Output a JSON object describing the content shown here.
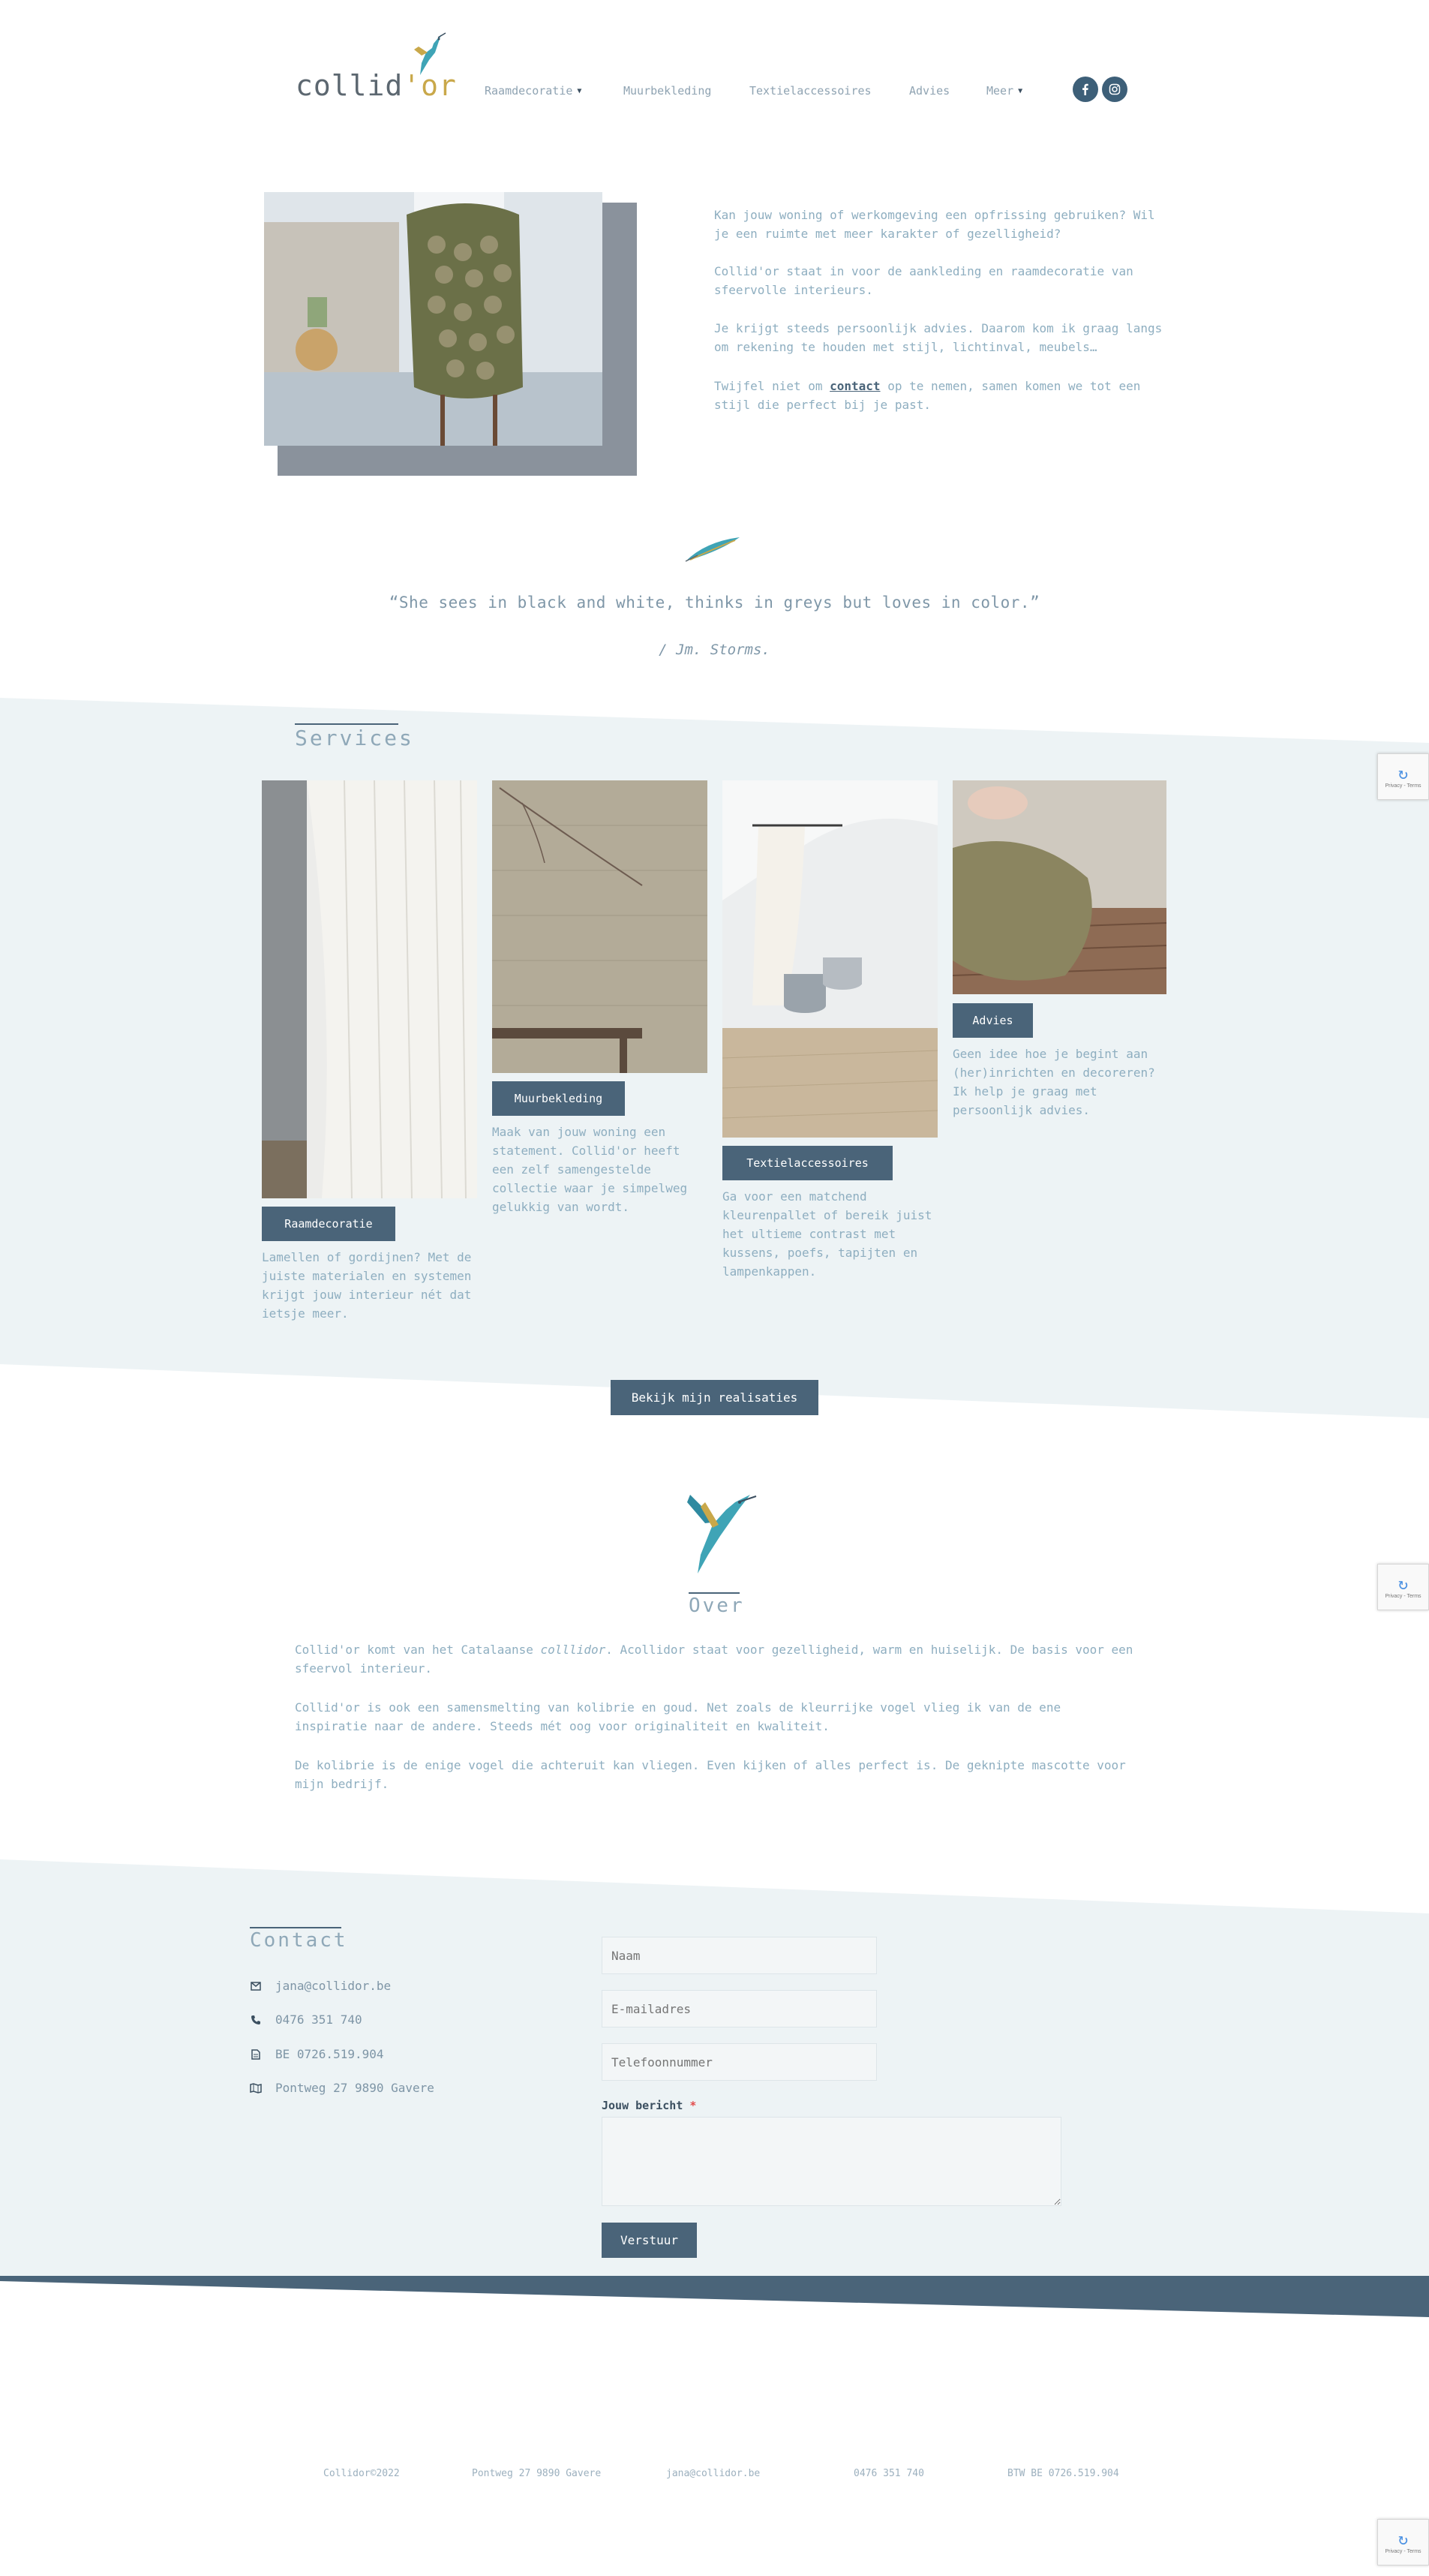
{
  "brand": {
    "name_main": "collid",
    "name_accent": "'or",
    "accent_color": "#c9a84a"
  },
  "nav": {
    "items": [
      {
        "label": "Raamdecoratie",
        "has_dropdown": true
      },
      {
        "label": "Muurbekleding",
        "has_dropdown": false
      },
      {
        "label": "Textielaccessoires",
        "has_dropdown": false
      },
      {
        "label": "Advies",
        "has_dropdown": false
      },
      {
        "label": "Meer",
        "has_dropdown": true
      }
    ],
    "social": [
      "facebook-icon",
      "instagram-icon"
    ]
  },
  "intro": {
    "p1": "Kan jouw woning of werkomgeving een opfrissing gebruiken? Wil je een ruimte met meer karakter of gezelligheid?",
    "p2": "Collid'or staat in voor de aankleding en raamdecoratie van sfeervolle interieurs.",
    "p3": "Je krijgt steeds persoonlijk advies. Daarom kom ik graag langs om rekening te houden met stijl, lichtinval, meubels…",
    "p4_before": "Twijfel niet om ",
    "p4_link": "contact",
    "p4_after": " op te nemen, samen komen we tot een stijl die perfect bij je past."
  },
  "quote": {
    "text": "“She sees in black and white, thinks in greys but loves in color.”",
    "author": "/ Jm. Storms."
  },
  "services": {
    "title": "Services",
    "items": [
      {
        "label": "Raamdecoratie",
        "desc": "Lamellen of gordijnen? Met de juiste materialen en systemen krijgt jouw interieur nét dat ietsje meer."
      },
      {
        "label": "Muurbekleding",
        "desc": "Maak van jouw woning een statement. Collid'or heeft een zelf samengestelde collectie waar je simpelweg gelukkig van wordt."
      },
      {
        "label": "Textielaccessoires",
        "desc": "Ga voor een matchend kleurenpallet of bereik juist het ultieme contrast met kussens, poefs, tapijten en lampenkappen."
      },
      {
        "label": "Advies",
        "desc": "Geen idee hoe je begint aan (her)inrichten en decoreren? Ik help je graag met persoonlijk advies."
      }
    ],
    "cta": "Bekijk mijn realisaties"
  },
  "about": {
    "title": "Over",
    "p1_before": "Collid'or komt van het Catalaanse ",
    "p1_em": "colllidor",
    "p1_after": ". Acollidor staat voor gezelligheid, warm en huiselijk. De basis voor een sfeervol interieur.",
    "p2": "Collid'or is ook een samensmelting van kolibrie en goud. Net zoals de kleurrijke vogel vlieg ik van de ene inspiratie naar de andere. Steeds mét oog voor originaliteit en kwaliteit.",
    "p3": "De kolibrie is de enige vogel die achteruit kan vliegen. Even kijken of alles perfect is. De geknipte mascotte voor mijn bedrijf."
  },
  "contact": {
    "title": "Contact",
    "info": [
      {
        "icon": "envelope-icon",
        "text": "jana@collidor.be"
      },
      {
        "icon": "phone-icon",
        "text": "0476 351 740"
      },
      {
        "icon": "document-icon",
        "text": "BE 0726.519.904"
      },
      {
        "icon": "map-icon",
        "text": "Pontweg 27 9890 Gavere"
      }
    ],
    "form": {
      "name_placeholder": "Naam",
      "email_placeholder": "E-mailadres",
      "phone_placeholder": "Telefoonnummer",
      "message_label": "Jouw bericht",
      "required_mark": "*",
      "submit": "Verstuur"
    }
  },
  "footer": {
    "items": [
      "Collidor©2022",
      "Pontweg 27 9890 Gavere",
      "jana@collidor.be",
      "0476 351 740",
      "BTW BE 0726.519.904"
    ]
  },
  "recaptcha": {
    "text": "Privacy - Terms"
  }
}
